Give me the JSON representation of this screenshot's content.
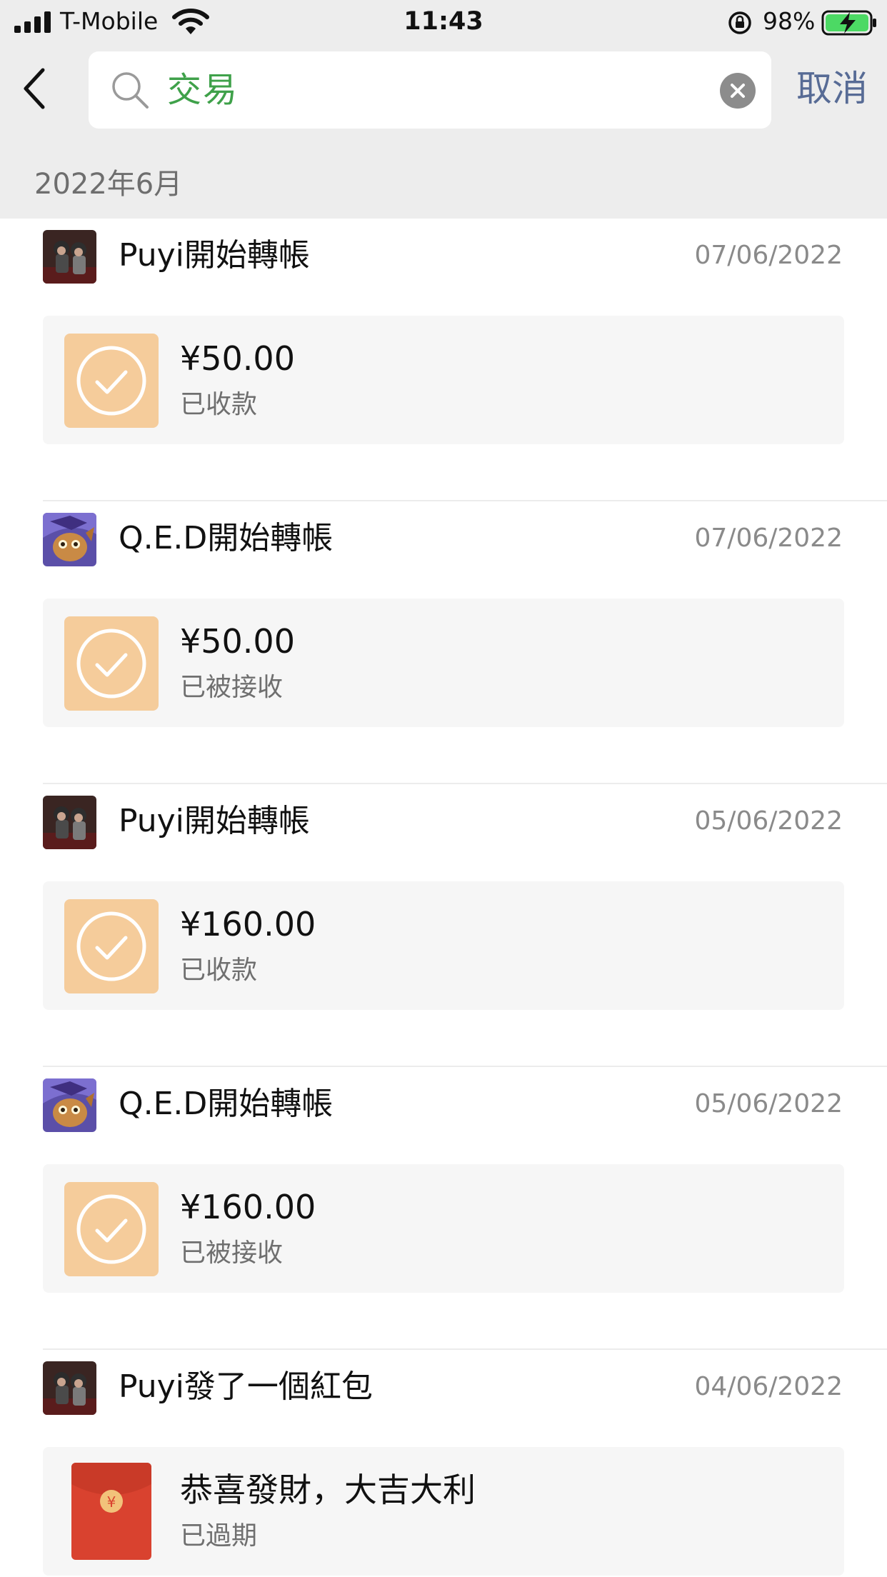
{
  "status_bar": {
    "carrier": "T-Mobile",
    "time": "11:43",
    "battery": "98%",
    "battery_level": 0.98
  },
  "search": {
    "query": "交易",
    "cancel_label": "取消"
  },
  "section": {
    "title": "2022年6月"
  },
  "entries": [
    {
      "sender": "Puyi開始轉帳",
      "date": "07/06/2022",
      "amount": "¥50.00",
      "status": "已收款",
      "avatar": "puyi",
      "kind": "transfer"
    },
    {
      "sender": "Q.E.D開始轉帳",
      "date": "07/06/2022",
      "amount": "¥50.00",
      "status": "已被接收",
      "avatar": "qed",
      "kind": "transfer"
    },
    {
      "sender": "Puyi開始轉帳",
      "date": "05/06/2022",
      "amount": "¥160.00",
      "status": "已收款",
      "avatar": "puyi",
      "kind": "transfer"
    },
    {
      "sender": "Q.E.D開始轉帳",
      "date": "05/06/2022",
      "amount": "¥160.00",
      "status": "已被接收",
      "avatar": "qed",
      "kind": "transfer"
    },
    {
      "sender": "Puyi發了一個紅包",
      "date": "04/06/2022",
      "amount": "恭喜發財，大吉大利",
      "status": "已過期",
      "avatar": "puyi",
      "kind": "red-packet",
      "packet_symbol": "¥"
    }
  ],
  "colors": {
    "header_bg": "#ededed",
    "search_text": "#3fa14a",
    "cancel_link": "#576b95",
    "transfer_icon_bg": "#f5cc9b",
    "red_packet": "#d9422f",
    "card_bg": "#f6f6f6"
  }
}
